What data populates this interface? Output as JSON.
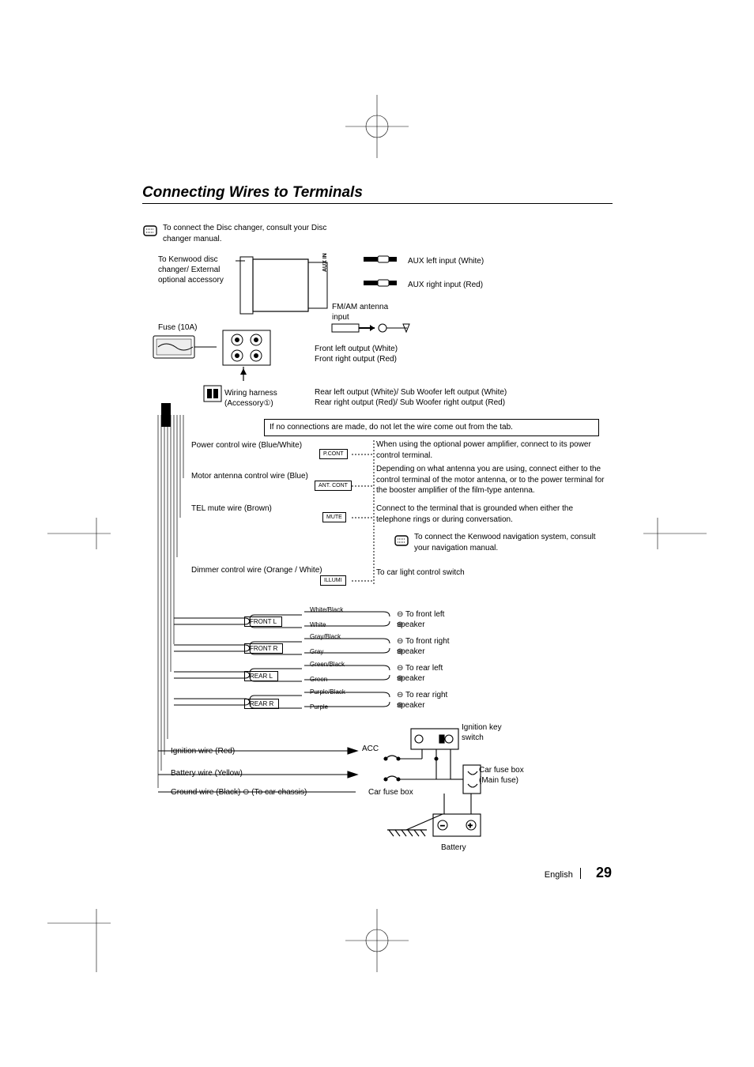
{
  "title": "Connecting Wires to Terminals",
  "intro": "To connect the Disc changer, consult your Disc changer manual.",
  "left_block": {
    "changer": "To Kenwood disc changer/ External optional accessory",
    "fuse": "Fuse (10A)",
    "harness": "Wiring harness (Accessory①)"
  },
  "top_right": {
    "aux_left": "AUX left input (White)",
    "aux_right": "AUX right input (Red)",
    "antenna": "FM/AM antenna input",
    "front_left_out": "Front left output (White)",
    "front_right_out": "Front right output (Red)",
    "rear_left_out": "Rear left output (White)/ Sub Woofer left output (White)",
    "rear_right_out": "Rear right output (Red)/ Sub Woofer right output (Red)"
  },
  "aux_in": "AUX IN",
  "tab_note": "If no connections are made, do not let the wire come out from the tab.",
  "wires": {
    "power_ctrl": "Power control wire (Blue/White)",
    "motor_ant": "Motor antenna control wire (Blue)",
    "tel_mute": "TEL mute wire (Brown)",
    "dimmer": "Dimmer control wire (Orange / White)"
  },
  "circuits": {
    "pcont": "P.CONT",
    "antcont": "ANT. CONT",
    "mute": "MUTE",
    "illumi": "ILLUMI"
  },
  "notes": {
    "pcont": "When using the optional power amplifier, connect to its power control terminal.",
    "antcont": "Depending on what antenna you are using, connect either to the control terminal of the motor antenna, or to the power terminal for the booster amplifier of the film-type antenna.",
    "mute": "Connect to the terminal that is grounded when either the telephone rings or during conversation.",
    "nav": "To connect the Kenwood navigation system, consult your navigation manual.",
    "dimmer": "To car light control switch"
  },
  "speakers": {
    "front_l": "FRONT  L",
    "front_r": "FRONT  R",
    "rear_l": "REAR  L",
    "rear_r": "REAR  R",
    "white_black": "White/Black",
    "white": "White",
    "gray_black": "Gray/Black",
    "gray": "Gray",
    "green_black": "Green/Black",
    "green": "Green",
    "purple_black": "Purple/Black",
    "purple": "Purple",
    "to_fl": "To front left speaker",
    "to_fr": "To front right speaker",
    "to_rl": "To rear left speaker",
    "to_rr": "To rear right speaker"
  },
  "bottom": {
    "ignition": "Ignition wire (Red)",
    "battery": "Battery wire (Yellow)",
    "ground": "Ground wire (Black) ⊖ (To car chassis)",
    "acc": "ACC",
    "car_fuse": "Car fuse box",
    "key_switch": "Ignition key switch",
    "main_fuse": "Car fuse box (Main fuse)",
    "battery_label": "Battery"
  },
  "footer": {
    "lang": "English",
    "page": "29"
  }
}
